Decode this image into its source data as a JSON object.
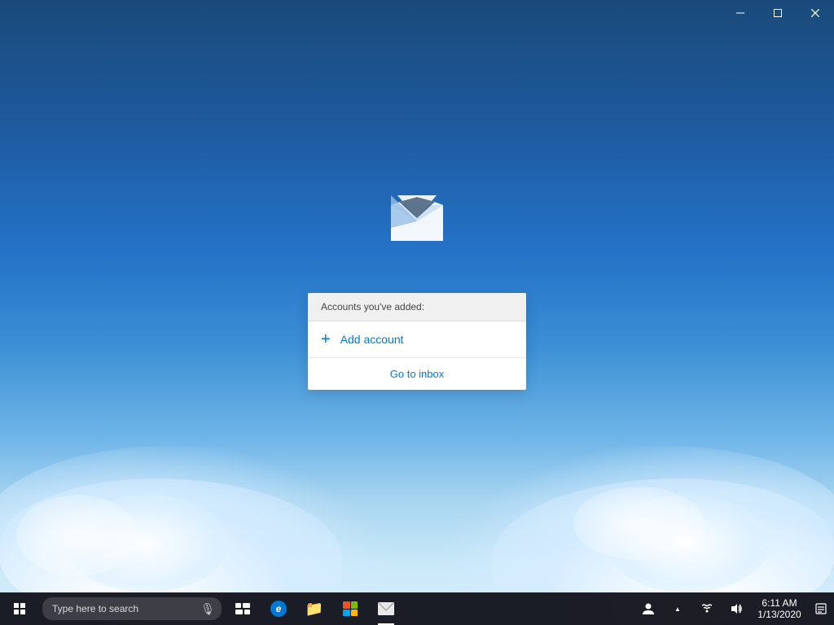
{
  "titlebar": {
    "minimize_label": "minimize",
    "maximize_label": "maximize",
    "close_label": "close"
  },
  "mail_app": {
    "icon_alt": "Mail App Icon",
    "card": {
      "header": "Accounts you've added:",
      "add_account_label": "Add account",
      "go_to_inbox_label": "Go to inbox"
    }
  },
  "taskbar": {
    "search_placeholder": "Type here to search",
    "time": "6:11 AM",
    "date": "1/13/2020",
    "start_label": "Start",
    "taskview_label": "Task View",
    "edge_label": "Microsoft Edge",
    "explorer_label": "File Explorer",
    "store_label": "Microsoft Store",
    "mail_label": "Mail",
    "search_label": "Search",
    "people_label": "People",
    "show_hidden_label": "Show hidden icons",
    "network_label": "Network",
    "notification_label": "Action Center",
    "mic_icon": "🎤"
  }
}
